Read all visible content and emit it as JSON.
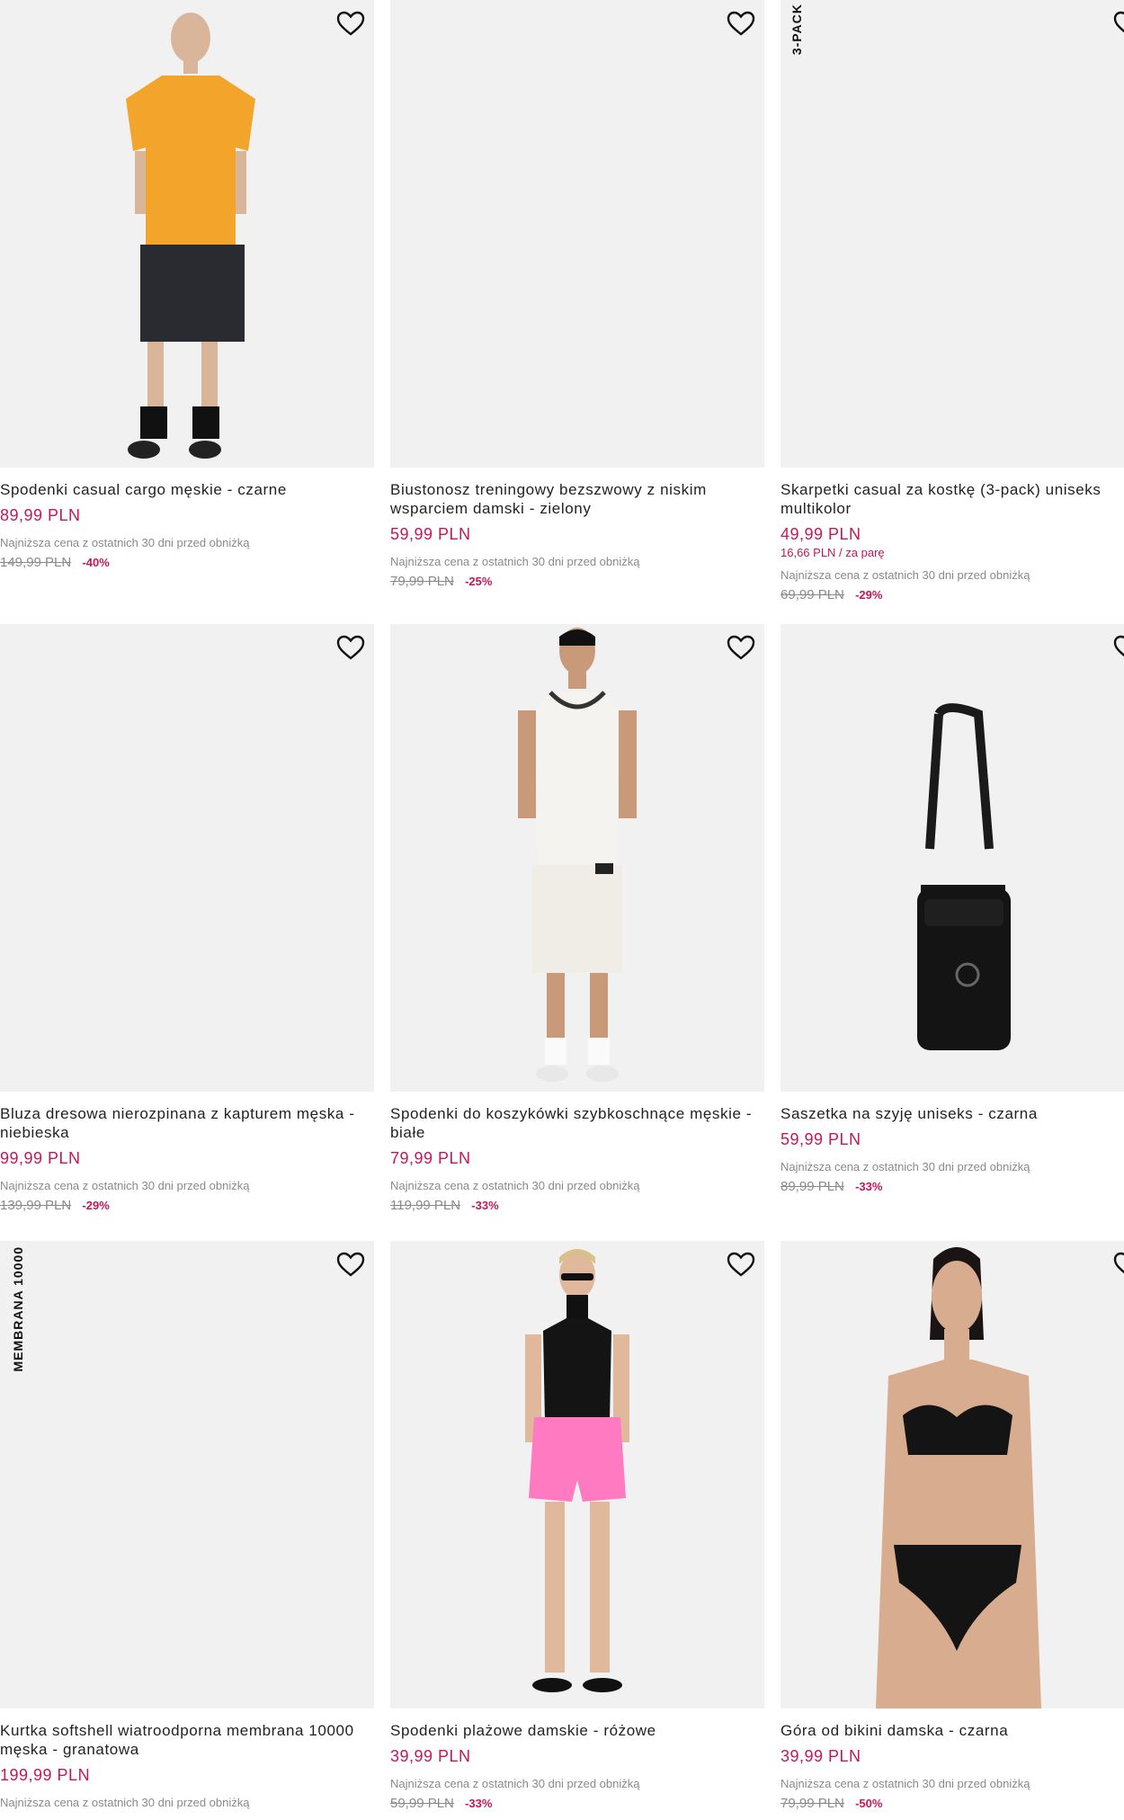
{
  "products": [
    {
      "title": "Spodenki casual cargo męskie - czarne",
      "price": "89,99 PLN",
      "lowest_note": "Najniższa cena z ostatnich 30 dni przed obniżką",
      "old_price": "149,99 PLN",
      "discount": "-40%"
    },
    {
      "title": "Biustonosz treningowy bezszwowy z niskim wsparciem damski - zielony",
      "price": "59,99 PLN",
      "lowest_note": "Najniższa cena z ostatnich 30 dni przed obniżką",
      "old_price": "79,99 PLN",
      "discount": "-25%"
    },
    {
      "badge": "3-PACK",
      "title": "Skarpetki casual za kostkę (3-pack) uniseks multikolor",
      "price": "49,99 PLN",
      "unit_price": "16,66 PLN / za parę",
      "lowest_note": "Najniższa cena z ostatnich 30 dni przed obniżką",
      "old_price": "69,99 PLN",
      "discount": "-29%"
    },
    {
      "title": "Bluza dresowa nierozpinana z kapturem męska - niebieska",
      "price": "99,99 PLN",
      "lowest_note": "Najniższa cena z ostatnich 30 dni przed obniżką",
      "old_price": "139,99 PLN",
      "discount": "-29%"
    },
    {
      "title": "Spodenki do koszykówki szybkoschnące męskie - białe",
      "price": "79,99 PLN",
      "lowest_note": "Najniższa cena z ostatnich 30 dni przed obniżką",
      "old_price": "119,99 PLN",
      "discount": "-33%"
    },
    {
      "title": "Saszetka na szyję uniseks - czarna",
      "price": "59,99 PLN",
      "lowest_note": "Najniższa cena z ostatnich 30 dni przed obniżką",
      "old_price": "89,99 PLN",
      "discount": "-33%"
    },
    {
      "badge": "MEMBRANA 10000",
      "title": "Kurtka softshell wiatroodporna membrana 10000 męska - granatowa",
      "price": "199,99 PLN",
      "lowest_note": "Najniższa cena z ostatnich 30 dni przed obniżką"
    },
    {
      "title": "Spodenki plażowe damskie - różowe",
      "price": "39,99 PLN",
      "lowest_note": "Najniższa cena z ostatnich 30 dni przed obniżką",
      "old_price": "59,99 PLN",
      "discount": "-33%"
    },
    {
      "title": "Góra od bikini damska - czarna",
      "price": "39,99 PLN",
      "lowest_note": "Najniższa cena z ostatnich 30 dni przed obniżką",
      "old_price": "79,99 PLN",
      "discount": "-50%"
    }
  ],
  "icons": {
    "favorite": "heart-outline-icon"
  },
  "colors": {
    "price": "#c2185b",
    "image_bg": "#f1f1f1"
  }
}
